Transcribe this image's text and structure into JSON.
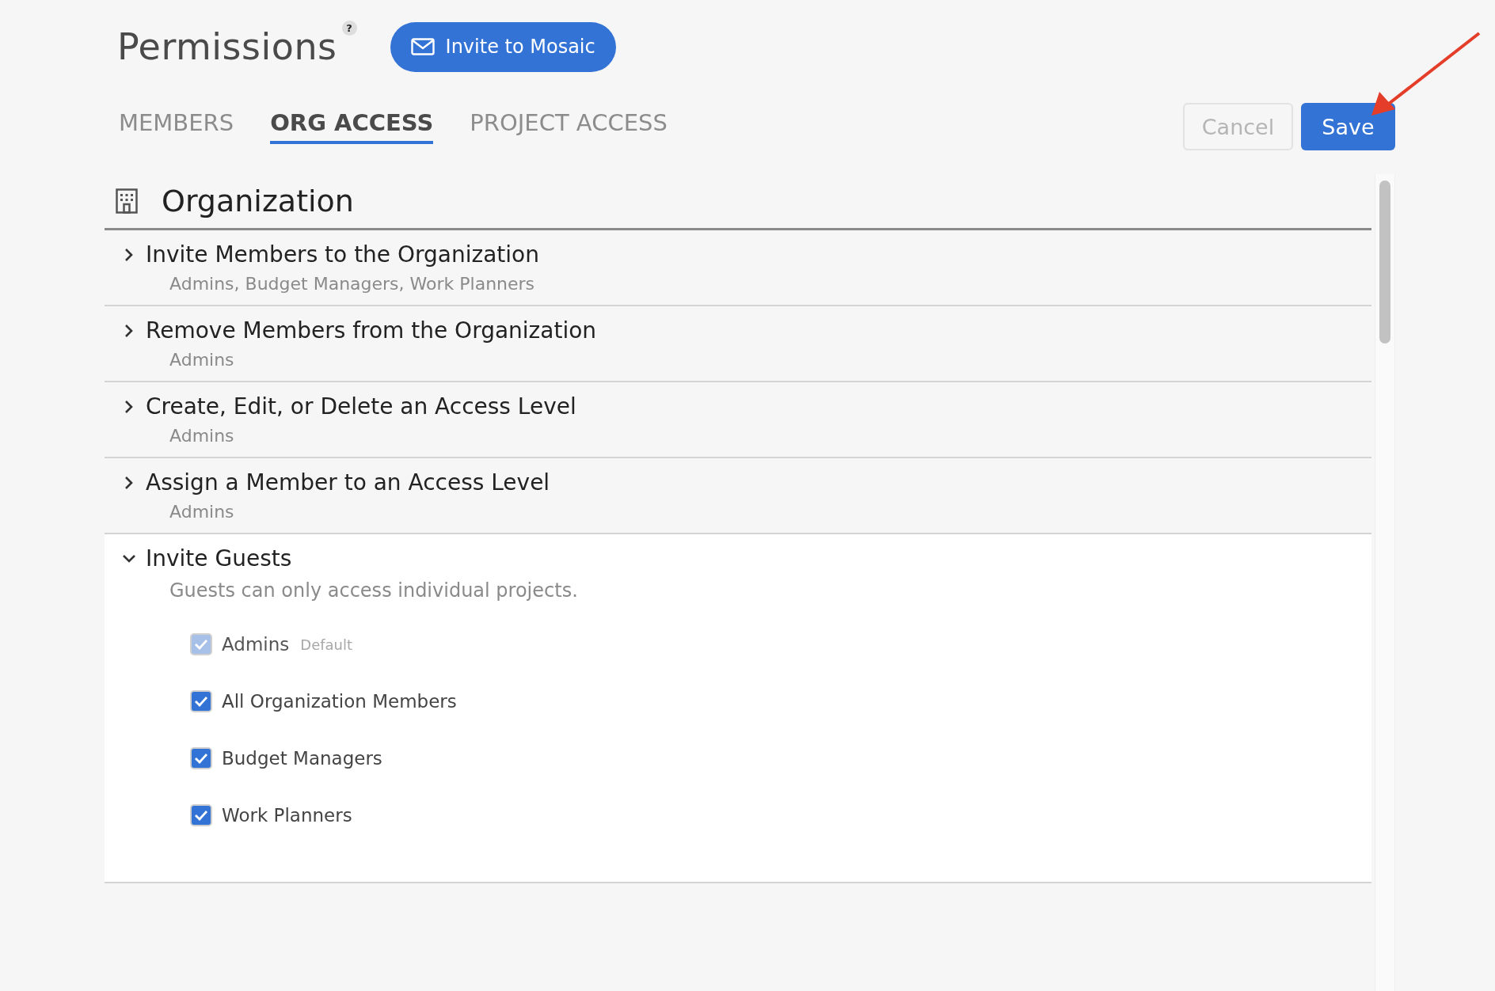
{
  "header": {
    "title": "Permissions",
    "help": "?",
    "invite_button": "Invite to Mosaic"
  },
  "tabs": [
    {
      "label": "MEMBERS",
      "selected": false
    },
    {
      "label": "ORG ACCESS",
      "selected": true
    },
    {
      "label": "PROJECT ACCESS",
      "selected": false
    }
  ],
  "actions": {
    "cancel": "Cancel",
    "save": "Save"
  },
  "section": {
    "title": "Organization",
    "rows": [
      {
        "title": "Invite Members to the Organization",
        "subtitle": "Admins, Budget Managers, Work Planners",
        "expanded": false
      },
      {
        "title": "Remove Members from the Organization",
        "subtitle": "Admins",
        "expanded": false
      },
      {
        "title": "Create, Edit, or Delete an Access Level",
        "subtitle": "Admins",
        "expanded": false
      },
      {
        "title": "Assign a Member to an Access Level",
        "subtitle": "Admins",
        "expanded": false
      },
      {
        "title": "Invite Guests",
        "subtitle": "Guests can only access individual projects.",
        "expanded": true,
        "options": [
          {
            "label": "Admins",
            "badge": "Default",
            "checked": true,
            "disabled": true
          },
          {
            "label": "All Organization Members",
            "checked": true,
            "disabled": false
          },
          {
            "label": "Budget Managers",
            "checked": true,
            "disabled": false
          },
          {
            "label": "Work Planners",
            "checked": true,
            "disabled": false
          }
        ]
      }
    ]
  }
}
